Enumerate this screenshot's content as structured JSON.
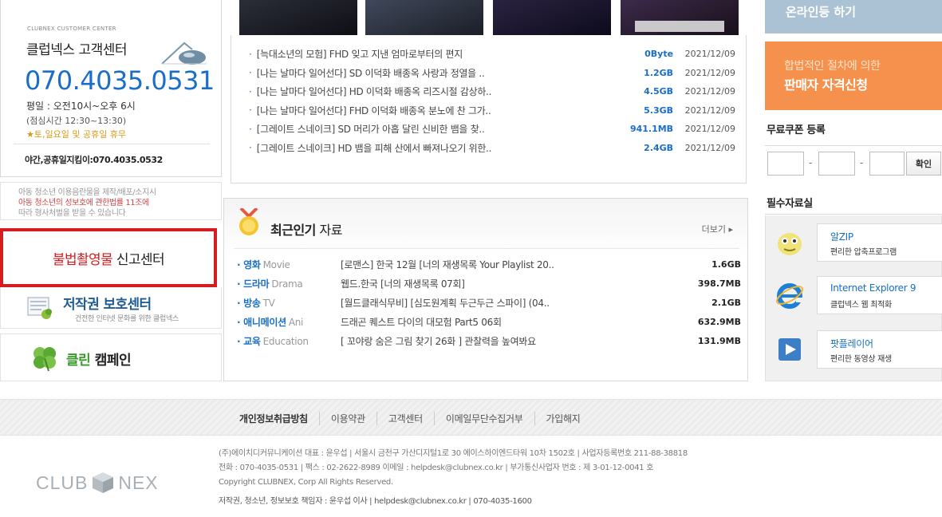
{
  "customer_center": {
    "eyebrow": "CLUBNEX CUSTOMER CENTER",
    "title": "클럽넥스 고객센터",
    "phone": "070.4035.0531",
    "hours": "평일 : 오전10시~오후 6시",
    "lunch": "(점심시간 12:30~13:30)",
    "holiday": "★토,일요일 및 공휴일 휴무",
    "night_line": "야간,공휴일지킴이:070.4035.0532"
  },
  "youth_notice": {
    "line1": "아동 청소년 이용음란물을 제작/배포/소지시",
    "line2": "아동 청소년의 성보호에 관한법률 11조에",
    "line3": "따라 형사처벌을 받을 수 있습니다"
  },
  "report_center": {
    "red": "불법촬영물",
    "rest": "신고센터"
  },
  "copyright_center": {
    "title": "저작권 보호센터",
    "sub": "건전한 인터넷 문화를 위한 클럽넥스"
  },
  "clean_campaign": {
    "green": "클린",
    "rest": "캠페인"
  },
  "latest": [
    {
      "title": "[늑대소년의 모험] FHD 잊고 지낸 엄마로부터의 편지",
      "size": "0Byte",
      "date": "2021/12/09"
    },
    {
      "title": "[나는 날마다 일어선다] SD 이덕화 배종옥 사랑과 정열을 ..",
      "size": "1.2GB",
      "date": "2021/12/09"
    },
    {
      "title": "[나는 날마다 일어선다] HD 이덕화 배종옥 리즈시절 감상하..",
      "size": "4.5GB",
      "date": "2021/12/09"
    },
    {
      "title": "[나는 날마다 일어선다] FHD 이덕화 배종옥 분노에 찬 그가..",
      "size": "5.3GB",
      "date": "2021/12/09"
    },
    {
      "title": "[그레이트 스네이크] SD 머리가 아홉 달린 신비한 뱀을 찾..",
      "size": "941.1MB",
      "date": "2021/12/09"
    },
    {
      "title": "[그레이트 스네이크] HD 뱀을 피해 산에서 빠져나오기 위한..",
      "size": "2.4GB",
      "date": "2021/12/09"
    }
  ],
  "popular": {
    "title_bold": "최근인기",
    "title_rest": "자료",
    "more": "더보기 ▸",
    "items": [
      {
        "cat": "영화",
        "cat_en": "Movie",
        "title": "[로맨스] 한국 12월 [너의 재생목록 Your Playlist 20..",
        "size": "1.6GB"
      },
      {
        "cat": "드라마",
        "cat_en": "Drama",
        "title": "웹드.한국 [너의 재생목록 07회]",
        "size": "398.7MB"
      },
      {
        "cat": "방송",
        "cat_en": "TV",
        "title": "[월드클래식무비] [심도원계획 두근두근 스파이] (04..",
        "size": "2.1GB"
      },
      {
        "cat": "애니메이션",
        "cat_en": "Ani",
        "title": "드래곤 퀘스트 다이의 대모험 Part5 06회",
        "size": "632.9MB"
      },
      {
        "cat": "교육",
        "cat_en": "Education",
        "title": "[ 꼬야랑 숨은 그림 찾기 26화 ] 관찰력을 높여봐요",
        "size": "131.9MB"
      }
    ]
  },
  "right": {
    "top_banner": "온라인등 하기",
    "seller_line1": "합법적인 절차에 의한",
    "seller_line2": "판매자 자격신청",
    "coupon_title": "무료쿠폰 등록",
    "coupon_dash": "-",
    "coupon_btn": "확인",
    "essential_title": "필수자료실",
    "essentials": [
      {
        "name": "알ZIP",
        "desc": "편리한 압축프로그램",
        "icon": "alzip-icon"
      },
      {
        "name": "Internet Explorer 9",
        "desc": "클럽넥스 웹 최적화",
        "icon": "internet-explorer-icon"
      },
      {
        "name": "팟플레이어",
        "desc": "편리한 동영상 재생",
        "icon": "potplayer-icon"
      }
    ]
  },
  "footer": {
    "links": [
      "개인정보취급방침",
      "이용약관",
      "고객센터",
      "이메일무단수집거부",
      "가입해지"
    ],
    "logo_left": "CLUB",
    "logo_right": "NEX",
    "info1": "(주)에이치디커뮤니케이션 대표 : 윤우섭  |  서울시 금천구 가산디지털1로 30 에이스하이엔드타워 10차 1502호  |  사업자등록번호 211-88-38818",
    "info2": "전화 : 070-4035-0531  |  팩스 : 02-2622-8989  이메일 : helpdesk@clubnex.co.kr  |  부가통신사업자 번호 : 제 3-01-12-0041 호",
    "info3": "Copyright CLUBNEX, Corp All Rights Reserved.",
    "info4": "저작권, 청소년, 정보보호 책임자 : 윤우섭 이사  |  helpdesk@clubnex.co.kr  |  070-4035-1600"
  }
}
